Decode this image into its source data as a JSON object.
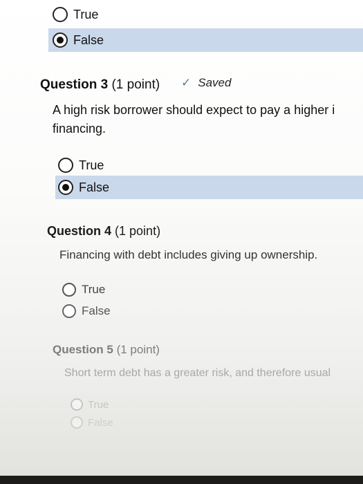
{
  "q2": {
    "options": [
      {
        "label": "True",
        "selected": false
      },
      {
        "label": "False",
        "selected": true
      }
    ]
  },
  "q3": {
    "title": "Question 3",
    "points": "(1 point)",
    "status": "Saved",
    "status_icon": "checkmark-icon",
    "text_line1": "A high risk borrower should expect to pay a higher i",
    "text_line2": "financing.",
    "options": [
      {
        "label": "True",
        "selected": false
      },
      {
        "label": "False",
        "selected": true
      }
    ]
  },
  "q4": {
    "title": "Question 4",
    "points": "(1 point)",
    "text": "Financing with debt includes giving up ownership.",
    "options": [
      {
        "label": "True",
        "selected": false
      },
      {
        "label": "False",
        "selected": false
      }
    ]
  },
  "q5": {
    "title": "Question 5",
    "points": "(1 point)",
    "text": "Short term debt has a greater risk, and therefore usual",
    "options": [
      {
        "label": "True",
        "selected": false
      },
      {
        "label": "False",
        "selected": false
      }
    ]
  },
  "colors": {
    "selected_row": "#c9d8ea",
    "check_accent": "#5c7aa0"
  }
}
